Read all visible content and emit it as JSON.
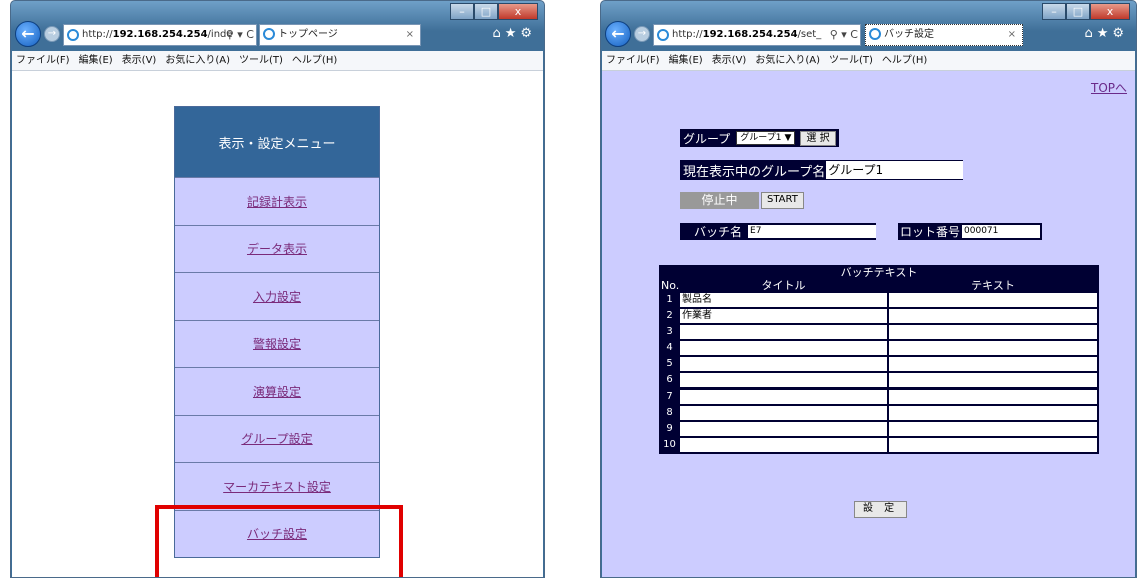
{
  "left_window": {
    "address": {
      "prefix": "http://",
      "host": "192.168.254.254",
      "path": "/inde"
    },
    "tab_title": "トップページ",
    "menubar": [
      "ファイル(F)",
      "編集(E)",
      "表示(V)",
      "お気に入り(A)",
      "ツール(T)",
      "ヘルプ(H)"
    ],
    "menu": {
      "title": "表示・設定メニュー",
      "items": [
        "記録計表示",
        "データ表示",
        "入力設定",
        "警報設定",
        "演算設定",
        "グループ設定",
        "マーカテキスト設定",
        "バッチ設定"
      ]
    }
  },
  "right_window": {
    "address": {
      "prefix": "http://",
      "host": "192.168.254.254",
      "path": "/set_"
    },
    "tab_title": "バッチ設定",
    "menubar": [
      "ファイル(F)",
      "編集(E)",
      "表示(V)",
      "お気に入り(A)",
      "ツール(T)",
      "ヘルプ(H)"
    ],
    "top_link": "TOPへ",
    "group": {
      "label": "グループ",
      "selected": "グループ1",
      "select_button": "選 択"
    },
    "current_group": {
      "label": "現在表示中のグループ名",
      "value": "グループ1"
    },
    "status": {
      "label": "停止中",
      "start_button": "START"
    },
    "batch_name": {
      "label": "バッチ名",
      "value": "E7"
    },
    "lot_number": {
      "label": "ロット番号",
      "value": "000071"
    },
    "batch_table": {
      "caption": "バッチテキスト",
      "headers": {
        "no": "No.",
        "title": "タイトル",
        "text": "テキスト"
      },
      "rows": [
        {
          "no": "1",
          "title": "製品名",
          "text": ""
        },
        {
          "no": "2",
          "title": "作業者",
          "text": ""
        },
        {
          "no": "3",
          "title": "",
          "text": ""
        },
        {
          "no": "4",
          "title": "",
          "text": ""
        },
        {
          "no": "5",
          "title": "",
          "text": ""
        },
        {
          "no": "6",
          "title": "",
          "text": ""
        },
        {
          "no": "7",
          "title": "",
          "text": ""
        },
        {
          "no": "8",
          "title": "",
          "text": ""
        },
        {
          "no": "9",
          "title": "",
          "text": ""
        },
        {
          "no": "10",
          "title": "",
          "text": ""
        }
      ]
    },
    "set_button": "設 定"
  },
  "window_controls": {
    "minimize": "–",
    "maximize": "□",
    "close": "x"
  },
  "icons": {
    "back": "arrow-left",
    "forward": "arrow-right",
    "nav": [
      "home-icon",
      "star-icon",
      "gear-icon"
    ]
  },
  "colors": {
    "menu_header": "#336699",
    "menu_item_bg": "#ccccff",
    "highlight": "#e00000",
    "dark_label_bg": "#000033",
    "page_bg_right": "#ccccff"
  }
}
